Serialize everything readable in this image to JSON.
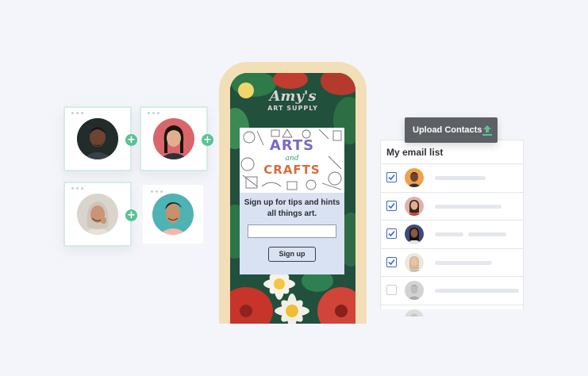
{
  "colors": {
    "background": "#f4f5fa",
    "card_border": "#d5ebe4",
    "plus": "#5ac296",
    "phone_frame": "#f2dfb7",
    "popup_bg": "#d9e2f2",
    "checkbox": "#3b69c9",
    "upload_button": "#5d6166",
    "upload_icon": "#5ac296"
  },
  "contacts": [
    {
      "avatar_bg": "#6aa8a3",
      "skin": "#6b4530",
      "hair": "#1d1612",
      "shirt": "#3a4048",
      "icon": "person-avatar-icon"
    },
    {
      "avatar_bg": "#d8666b",
      "skin": "#e0b08e",
      "hair": "#1b1411",
      "shirt": "#2f3338",
      "icon": "person-avatar-icon"
    },
    {
      "avatar_bg": "#d9d4cc",
      "skin": "#c99575",
      "hair": "#cfc6bb",
      "shirt": "#e8e1d7",
      "icon": "person-avatar-icon"
    },
    {
      "avatar_bg": "#4fb3b4",
      "skin": "#c8906c",
      "hair": "#2a1c15",
      "shirt": "#f2b8a8",
      "icon": "person-avatar-icon"
    }
  ],
  "phone": {
    "brand_name": "Amy's",
    "brand_sub": "ART SUPPLY",
    "art_title_1": "ARTS",
    "art_title_and": "and",
    "art_title_2": "CRAFTS",
    "tagline": "Sign up for tips and hints all things art.",
    "input_placeholder": "",
    "button_label": "Sign up"
  },
  "upload": {
    "label": "Upload Contacts",
    "icon": "upload-icon"
  },
  "email_list": {
    "title": "My email list",
    "rows": [
      {
        "checked": true,
        "avatar_bg": "#f0a24a",
        "skin": "#6b4530",
        "hair": "#1d1612"
      },
      {
        "checked": true,
        "avatar_bg": "#e2b0ab",
        "skin": "#e0b08e",
        "hair": "#3b2419"
      },
      {
        "checked": true,
        "avatar_bg": "#3e4a7a",
        "skin": "#8b5a3e",
        "hair": "#1b1411"
      },
      {
        "checked": true,
        "avatar_bg": "#ede7e2",
        "skin": "#eac2a4",
        "hair": "#d7b890"
      },
      {
        "checked": false,
        "avatar_bg": "#d3d3d3",
        "skin": "#b9b9b9",
        "hair": "#9a9a9a"
      },
      {
        "checked": false,
        "avatar_bg": "#dcdcdc",
        "skin": "#c4c4c4",
        "hair": "#a8a8a8"
      }
    ]
  }
}
